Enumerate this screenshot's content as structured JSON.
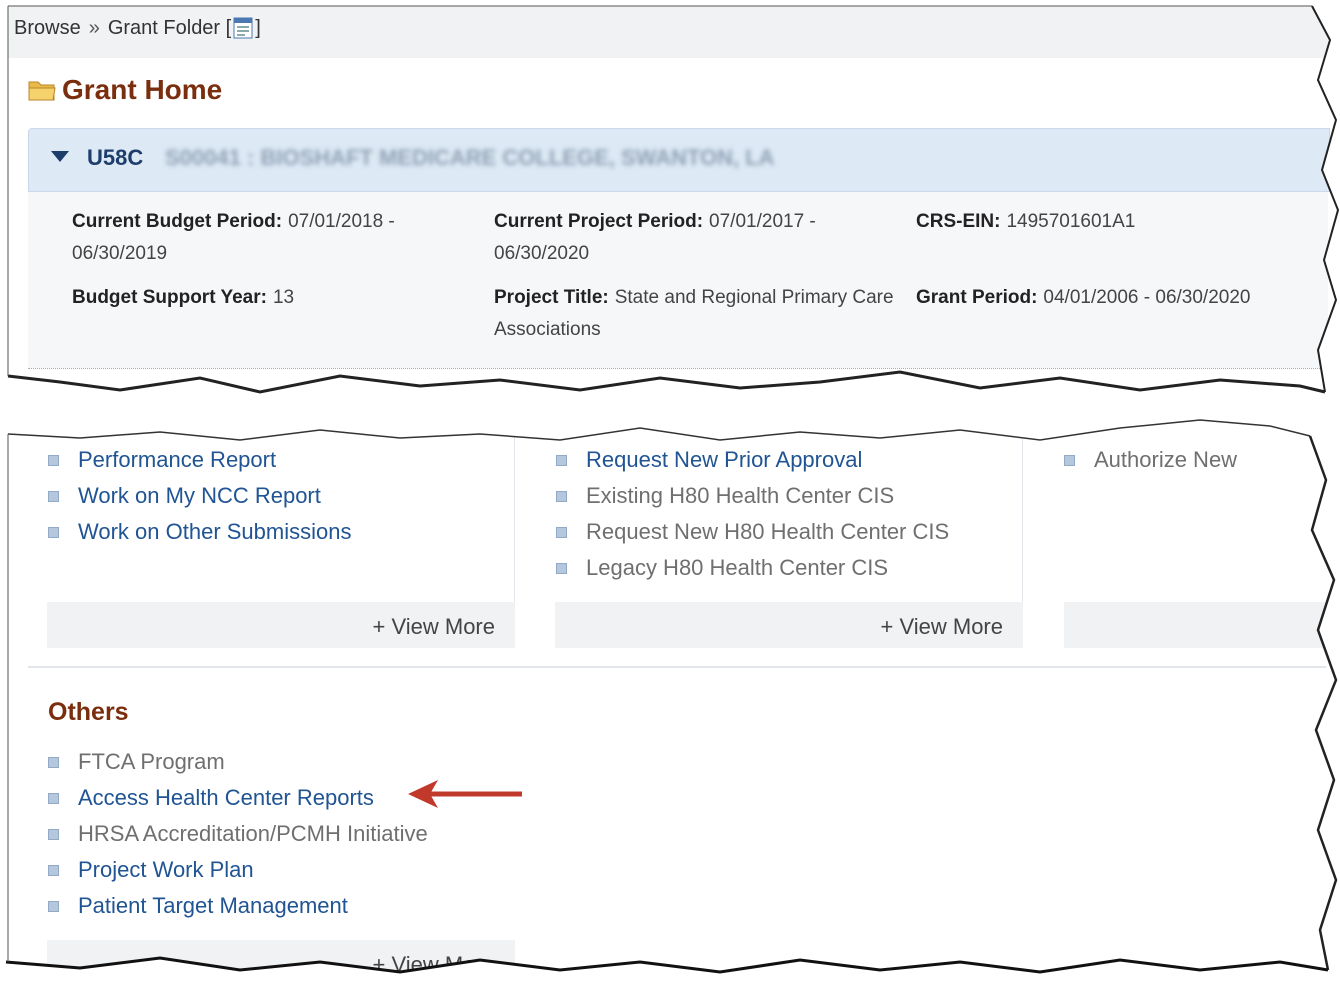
{
  "breadcrumb": {
    "browse": "Browse",
    "separator": "»",
    "grant_folder": "Grant Folder",
    "open_bracket": "[",
    "close_bracket": "]"
  },
  "page_title": "Grant Home",
  "grant": {
    "id_prefix": "U58C",
    "id_rest_blurred": "S00041 : BIOSHAFT MEDICARE COLLEGE, SWANTON, LA"
  },
  "details": {
    "current_budget_period": {
      "label": "Current Budget Period:",
      "value": "07/01/2018 - 06/30/2019"
    },
    "current_project_period": {
      "label": "Current Project Period:",
      "value": "07/01/2017 - 06/30/2020"
    },
    "crs_ein": {
      "label": "CRS-EIN:",
      "value": "1495701601A1"
    },
    "budget_support_year": {
      "label": "Budget Support Year:",
      "value": "13"
    },
    "project_title": {
      "label": "Project Title:",
      "value": "State and Regional Primary Care Associations"
    },
    "grant_period": {
      "label": "Grant Period:",
      "value": "04/01/2006 - 06/30/2020"
    }
  },
  "column1": {
    "items": [
      {
        "label": "Performance Report"
      },
      {
        "label": "Work on My NCC Report"
      },
      {
        "label": "Work on Other Submissions"
      }
    ],
    "view_more": "+ View More"
  },
  "column2": {
    "items": [
      {
        "label": "Request New Prior Approval"
      },
      {
        "label": "Existing H80 Health Center CIS"
      },
      {
        "label": "Request New H80 Health Center CIS"
      },
      {
        "label": "Legacy H80 Health Center CIS"
      }
    ],
    "view_more": "+ View More"
  },
  "column3": {
    "items": [
      {
        "label": "Authorize New"
      }
    ]
  },
  "others": {
    "title": "Others",
    "items": [
      {
        "label": "FTCA Program"
      },
      {
        "label": "Access Health Center Reports"
      },
      {
        "label": "HRSA Accreditation/PCMH Initiative"
      },
      {
        "label": "Project Work Plan"
      },
      {
        "label": "Patient Target Management"
      }
    ],
    "view_more": "+ View More"
  },
  "colors": {
    "accent_title": "#7a2e0e",
    "link_blue": "#205493",
    "annotation_arrow": "#c0392b"
  }
}
